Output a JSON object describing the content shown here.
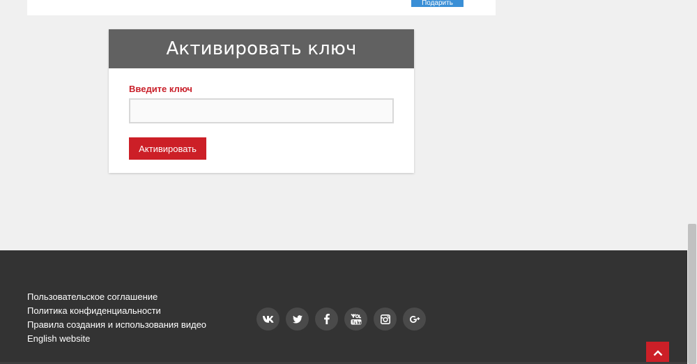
{
  "top_strip": {
    "button_label": "Подарить"
  },
  "card": {
    "title": "Активировать ключ",
    "field_label": "Введите ключ",
    "input_value": "",
    "input_placeholder": "",
    "button_label": "Активировать"
  },
  "footer": {
    "links": [
      "Пользовательское соглашение",
      "Политика конфиденциальности",
      "Правила создания и использования видео",
      "English website"
    ],
    "social_icons": [
      "vk-icon",
      "twitter-icon",
      "facebook-icon",
      "youtube-icon",
      "instagram-icon",
      "google-plus-icon"
    ]
  },
  "colors": {
    "accent_red": "#cc1f27",
    "header_gray": "#616161",
    "footer_bg": "#333333",
    "blue_button": "#3a8fd6"
  }
}
